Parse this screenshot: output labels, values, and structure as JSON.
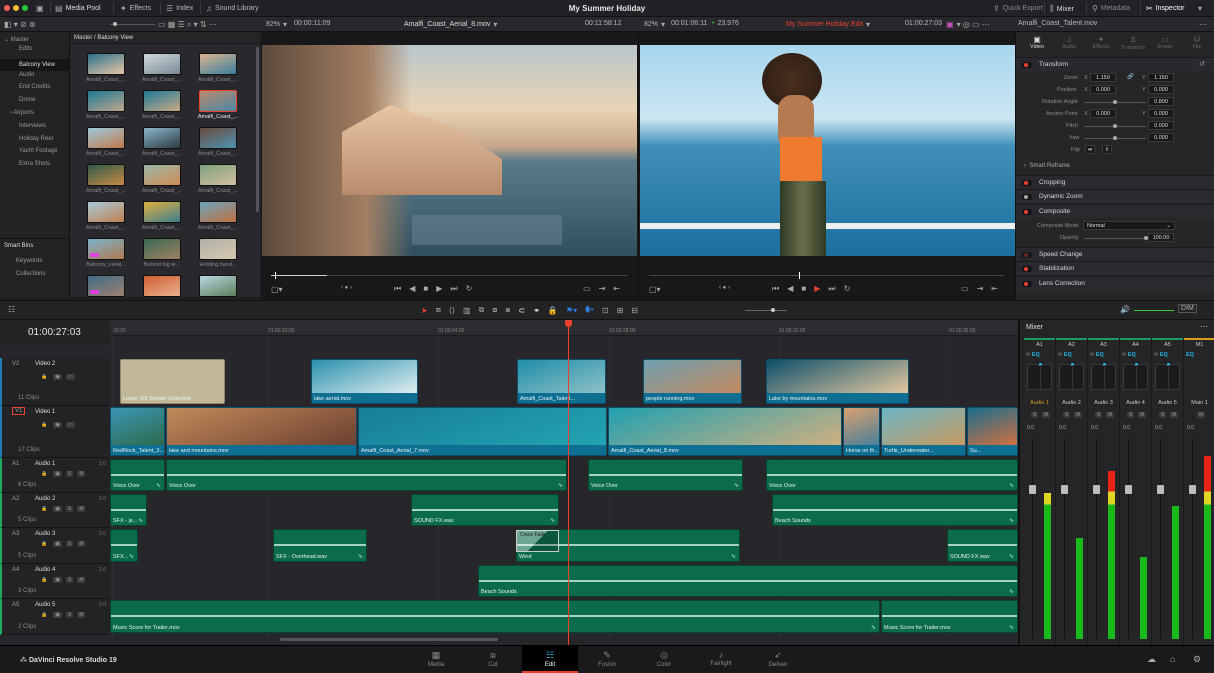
{
  "app": {
    "project_title": "My Summer Holiday",
    "product": "DaVinci Resolve Studio 19"
  },
  "topbar": {
    "media_pool": "Media Pool",
    "effects": "Effects",
    "index": "Index",
    "sound_library": "Sound Library",
    "quick_export": "Quick Export",
    "mixer": "Mixer",
    "metadata": "Metadata",
    "inspector": "Inspector"
  },
  "source_viewer": {
    "zoom": "82%",
    "duration": "00:00:11:09",
    "clip": "Amalfi_Coast_Aerial_8.mov",
    "timecode": "00:11:58:12",
    "progress": 0.03
  },
  "record_viewer": {
    "zoom": "82%",
    "duration": "00:01:06:11",
    "fps": "23.976",
    "timeline": "My Summer Holiday Edit",
    "timecode": "01:00:27:03",
    "progress": 0.42
  },
  "bins": {
    "root": "Master",
    "items": [
      "Edits",
      "Balcony View",
      "Audio",
      "End Credits",
      "Drone",
      "Airports",
      "Interviews",
      "Holiday Reel",
      "Yacht Footage",
      "Extra Shots"
    ],
    "selected": "Balcony View",
    "smart_bins": "Smart Bins",
    "smart_items": [
      "Keywords",
      "Collections"
    ]
  },
  "pool": {
    "path": "Master / Balcony View",
    "clips": [
      "Amalfi_Coast_...",
      "Amalfi_Coast_...",
      "Amalfi_Coast_...",
      "Amalfi_Coast_...",
      "Amalfi_Coast_...",
      "Amalfi_Coast_...",
      "Amalfi_Coast_...",
      "Amalfi_Coast_...",
      "Amalfi_Coast_...",
      "Amalfi_Coast_...",
      "Amalfi_Coast_...",
      "Amalfi_Coast_...",
      "Amalfi_Coast_...",
      "Amalfi_Coast_...",
      "Amalfi_Coast_...",
      "Balcony_viewi...",
      "Behind big le...",
      "Holding hand...",
      "",
      "",
      ""
    ],
    "selected_index": 5
  },
  "inspector": {
    "clip": "Amalfi_Coast_Talent.mov",
    "tabs": [
      "Video",
      "Audio",
      "Effects",
      "Transition",
      "Image",
      "File"
    ],
    "active_tab": "Video",
    "transform": "Transform",
    "zoom_label": "Zoom",
    "zoom_x": "1.150",
    "zoom_y": "1.150",
    "position_label": "Position",
    "pos_x": "0.000",
    "pos_y": "0.000",
    "rotation_label": "Rotation Angle",
    "rotation": "0.800",
    "anchor_label": "Anchor Point",
    "anchor_x": "0.000",
    "anchor_y": "0.000",
    "pitch_label": "Pitch",
    "pitch": "0.000",
    "yaw_label": "Yaw",
    "yaw": "0.000",
    "flip_label": "Flip",
    "x": "X",
    "y": "Y",
    "smart_reframe": "Smart Reframe",
    "cropping": "Cropping",
    "dynamic_zoom": "Dynamic Zoom",
    "composite": "Composite",
    "composite_mode_label": "Composite Mode",
    "composite_mode": "Normal",
    "opacity_label": "Opacity",
    "opacity": "100.00",
    "speed_change": "Speed Change",
    "stabilization": "Stabilization",
    "lens_correction": "Lens Correction"
  },
  "timeline": {
    "timecode": "01:00:27:03",
    "ruler": [
      "01:00:16:00",
      "01:00:20:00",
      "01:00:24:00",
      "01:00:28:00",
      "01:00:32:00",
      "01:00:36:00"
    ],
    "tracks": [
      {
        "id": "V2",
        "name": "Video 2",
        "clips": "11 Clips",
        "type": "v"
      },
      {
        "id": "V1",
        "name": "Video 1",
        "clips": "17 Clips",
        "type": "v"
      },
      {
        "id": "A1",
        "name": "Audio 1",
        "clips": "8 Clips",
        "type": "a",
        "ch": "2.0"
      },
      {
        "id": "A2",
        "name": "Audio 2",
        "clips": "5 Clips",
        "type": "a",
        "ch": "2.0"
      },
      {
        "id": "A3",
        "name": "Audio 3",
        "clips": "5 Clips",
        "type": "a",
        "ch": "2.0"
      },
      {
        "id": "A4",
        "name": "Audio 4",
        "clips": "3 Clips",
        "type": "a",
        "ch": "2.0"
      },
      {
        "id": "A5",
        "name": "Audio 5",
        "clips": "2 Clips",
        "type": "a",
        "ch": "2.0"
      }
    ],
    "clips": [
      [
        "Lower 3rd Simple Underline",
        "lake aerial.mov",
        "Amalfi_Coast_Talent...",
        "people running.mov",
        "Lake by mountains.mov"
      ],
      [
        "RedRock_Talent_3...",
        "lake and mountains.mov",
        "Amalfi_Coast_Aerial_7.mov",
        "Amalfi_Coast_Aerial_8.mov",
        "Horse on th...",
        "Turtle_Underwater...",
        "Su..."
      ],
      [
        "Voice Over",
        "Voice Over",
        "Voice Over",
        "Voice Over"
      ],
      [
        "SFX - je...",
        "SOUND FX.wav",
        "Beach Sounds"
      ],
      [
        "SFX...",
        "SFX - Overhead.wav",
        "Wind",
        "SOUND FX.wav"
      ],
      [
        "Beach Sounds"
      ],
      [
        "Music Score for Trailer.mov",
        "Music Score for Trailer.mov"
      ]
    ],
    "transition": "Cross Fade",
    "solo": "S",
    "mute": "M"
  },
  "mixer": {
    "title": "Mixer",
    "channels": [
      {
        "id": "A1",
        "name": "Audio 1",
        "level": 0.78,
        "gain": "0.0"
      },
      {
        "id": "A2",
        "name": "Audio 2",
        "level": 0.54,
        "gain": "0.0"
      },
      {
        "id": "A3",
        "name": "Audio 3",
        "level": 0.9,
        "gain": "0.0"
      },
      {
        "id": "A4",
        "name": "Audio 4",
        "level": 0.44,
        "gain": "0.0"
      },
      {
        "id": "A5",
        "name": "Audio 5",
        "level": 0.71,
        "gain": "0.0"
      },
      {
        "id": "M1",
        "name": "Main 1",
        "level": 0.98,
        "gain": "0.0"
      }
    ],
    "fx": "fx",
    "eq": "EQ",
    "dim": "DIM"
  },
  "pages": [
    "Media",
    "Cut",
    "Edit",
    "Fusion",
    "Color",
    "Fairlight",
    "Deliver"
  ],
  "active_page": "Edit",
  "colors": {
    "accent": "#e8412f",
    "video_clip": "#0e6f93",
    "audio_clip": "#0c6b4a",
    "eq": "#27b5e8"
  }
}
